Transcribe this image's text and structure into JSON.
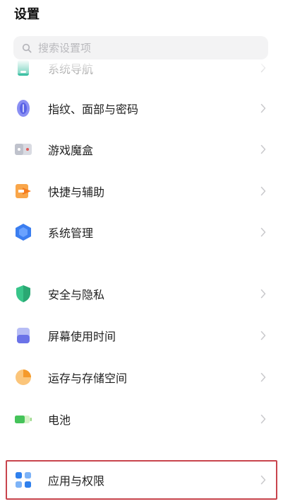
{
  "header": {
    "title": "设置"
  },
  "search": {
    "placeholder": "搜索设置项"
  },
  "colors": {
    "highlight_border": "#c8444d",
    "chevron": "#c9c9cc"
  },
  "settings": {
    "items": [
      {
        "label": "系统导航",
        "icon": "navigation-icon"
      },
      {
        "label": "指纹、面部与密码",
        "icon": "fingerprint-icon"
      },
      {
        "label": "游戏魔盒",
        "icon": "game-box-icon"
      },
      {
        "label": "快捷与辅助",
        "icon": "shortcut-icon"
      },
      {
        "label": "系统管理",
        "icon": "system-management-icon"
      },
      {
        "label": "安全与隐私",
        "icon": "security-shield-icon"
      },
      {
        "label": "屏幕使用时间",
        "icon": "screen-time-icon"
      },
      {
        "label": "运存与存储空间",
        "icon": "storage-pie-icon"
      },
      {
        "label": "电池",
        "icon": "battery-icon"
      },
      {
        "label": "应用与权限",
        "icon": "apps-permissions-icon"
      }
    ]
  }
}
